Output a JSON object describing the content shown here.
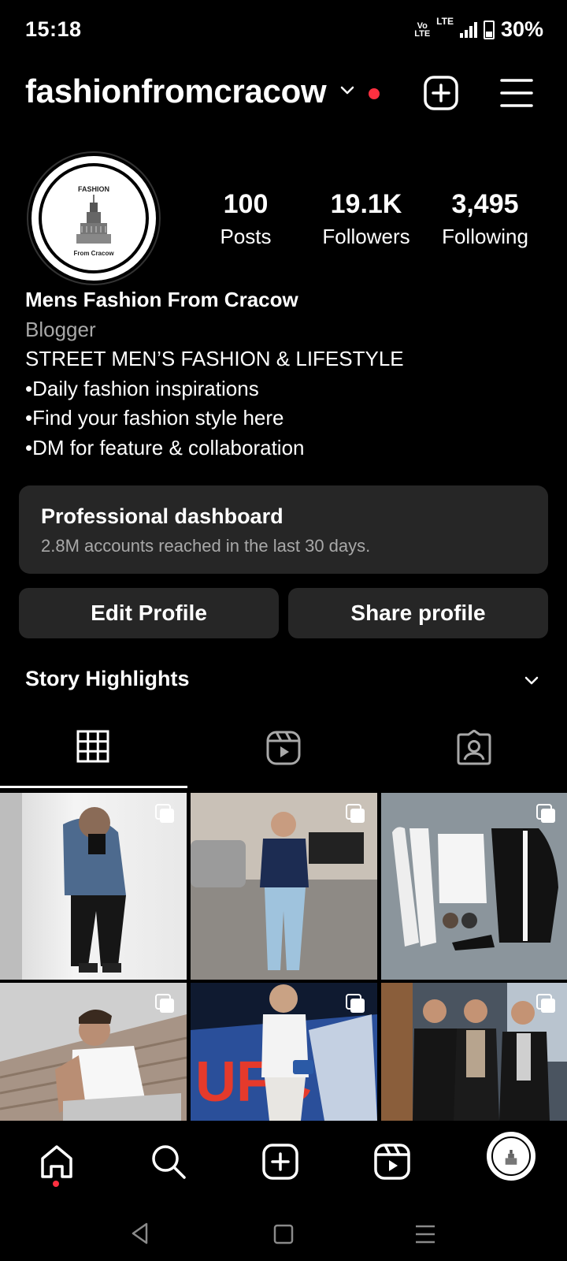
{
  "status_bar": {
    "time": "15:18",
    "volte": "Vo LTE",
    "lte": "LTE",
    "battery": "30%"
  },
  "header": {
    "username": "fashionfromcracow",
    "icons": [
      "chevron-down-icon",
      "notification-dot",
      "new-post-icon",
      "menu-icon"
    ]
  },
  "profile": {
    "avatar_text_top": "FASHION",
    "avatar_text_bottom": "From Cracow",
    "stats": [
      {
        "value": "100",
        "label": "Posts"
      },
      {
        "value": "19.1K",
        "label": "Followers"
      },
      {
        "value": "3,495",
        "label": "Following"
      }
    ],
    "name": "Mens Fashion From Cracow",
    "category": "Blogger",
    "bio_lines": [
      "STREET MEN’S FASHION & LIFESTYLE",
      "•Daily fashion inspirations",
      "•Find your fashion style here",
      "•DM for feature & collaboration"
    ]
  },
  "dashboard": {
    "title": "Professional dashboard",
    "subtitle": "2.8M accounts reached in the last 30 days."
  },
  "buttons": {
    "edit": "Edit Profile",
    "share": "Share profile"
  },
  "highlights": {
    "title": "Story Highlights"
  },
  "tabs": [
    "grid-icon",
    "reels-icon",
    "tagged-icon"
  ],
  "colors": {
    "background": "#000000",
    "card": "#262626",
    "muted": "#a8a8a8",
    "notification": "#ff3040"
  },
  "grid_posts": [
    {
      "desc": "man in denim jacket holding camera",
      "multi": true
    },
    {
      "desc": "man in navy shirt and light jeans in living room",
      "multi": true
    },
    {
      "desc": "flat lay of white sweatsuit and black puffer jacket",
      "multi": true
    },
    {
      "desc": "man in white t-shirt on stairs",
      "multi": true
    },
    {
      "desc": "man in white shirt in front of UFC sign",
      "multi": true
    },
    {
      "desc": "three men in leather jackets",
      "multi": true
    }
  ],
  "ufc_text": "UFC",
  "bottom_nav": [
    "home-icon",
    "search-icon",
    "create-icon",
    "reels-icon",
    "profile-avatar"
  ]
}
